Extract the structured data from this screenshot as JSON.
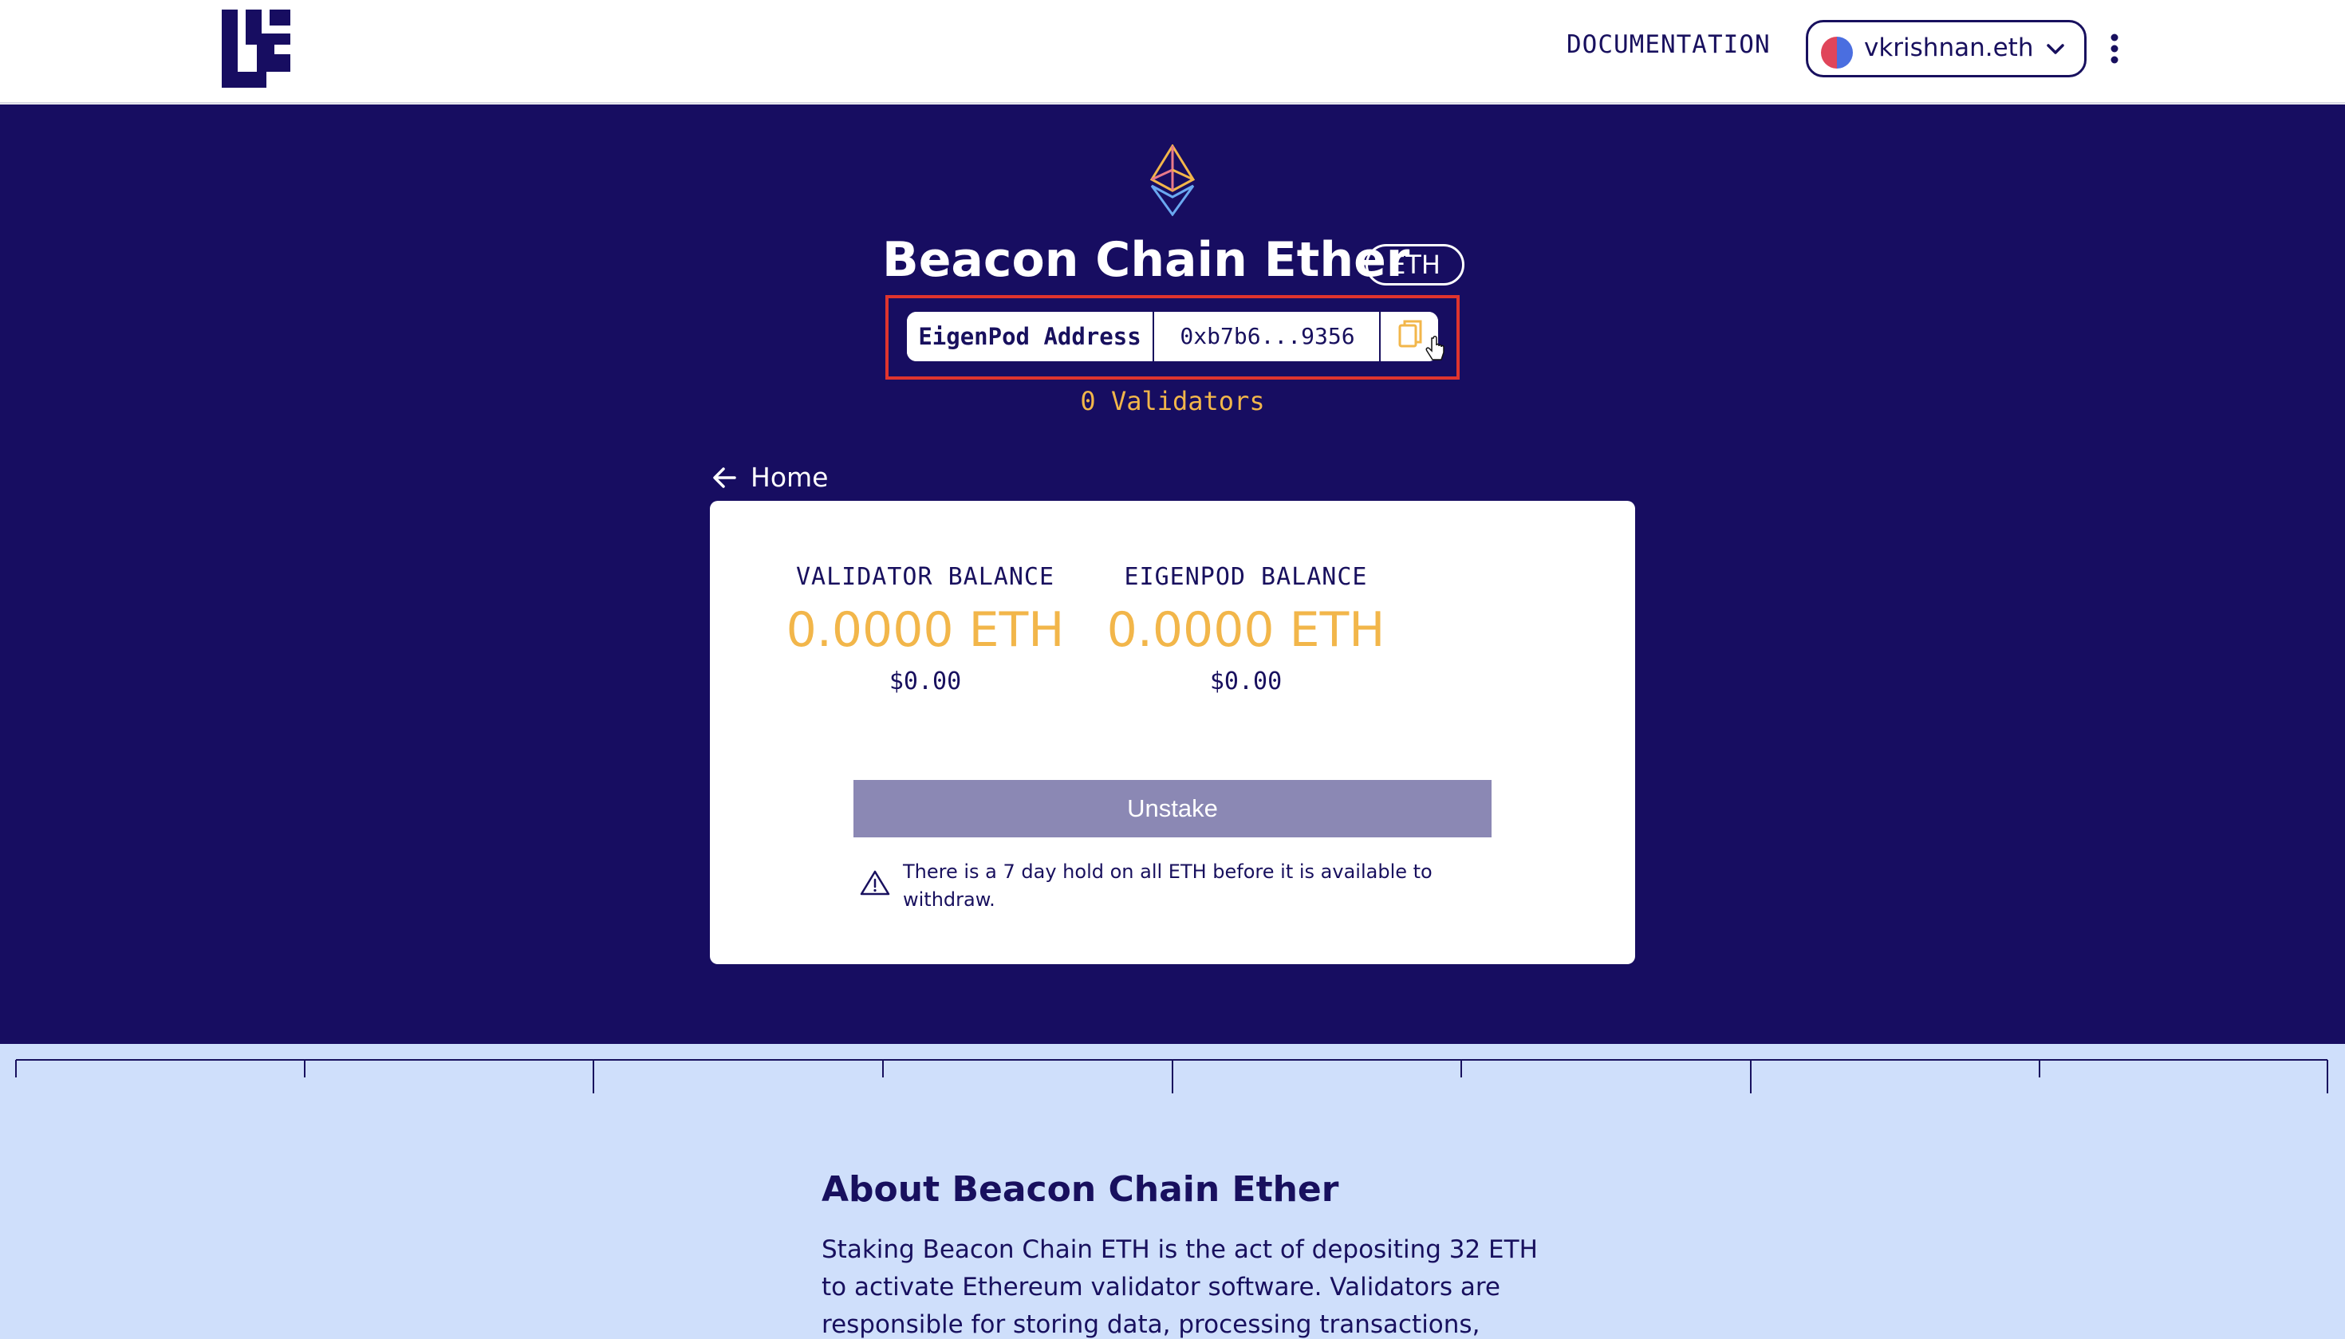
{
  "header": {
    "logo_icon": "eigenlayer-logo-icon",
    "documentation_label": "DOCUMENTATION",
    "wallet": {
      "name": "vkrishnan.eth",
      "avatar_icon": "wallet-avatar-icon",
      "chevron_icon": "chevron-down-icon"
    },
    "menu_icon": "kebab-menu-icon"
  },
  "hero": {
    "token_icon": "ethereum-icon",
    "title": "Beacon Chain Ether",
    "symbol": "ETH",
    "address_label": "EigenPod Address",
    "address_value": "0xb7b6...9356",
    "copy_icon": "copy-icon",
    "validators_text": "0 Validators",
    "back_label": "Home",
    "back_icon": "arrow-left-icon"
  },
  "card": {
    "validator_balance": {
      "label": "VALIDATOR BALANCE",
      "value": "0.0000 ETH",
      "usd": "$0.00"
    },
    "eigenpod_balance": {
      "label": "EIGENPOD BALANCE",
      "value": "0.0000 ETH",
      "usd": "$0.00"
    },
    "unstake_label": "Unstake",
    "warning_icon": "warning-triangle-icon",
    "warning_text": "There is a 7 day hold on all ETH before it is available to withdraw."
  },
  "about": {
    "title": "About Beacon Chain Ether",
    "text": "Staking Beacon Chain ETH is the act of depositing 32 ETH to activate Ethereum validator software. Validators are responsible for storing data, processing transactions,"
  },
  "colors": {
    "navy": "#170d61",
    "accent_gold": "#f2b64a",
    "highlight_red": "#e0342e",
    "light_blue": "#cfdffb",
    "disabled_button": "#8b88b4"
  }
}
